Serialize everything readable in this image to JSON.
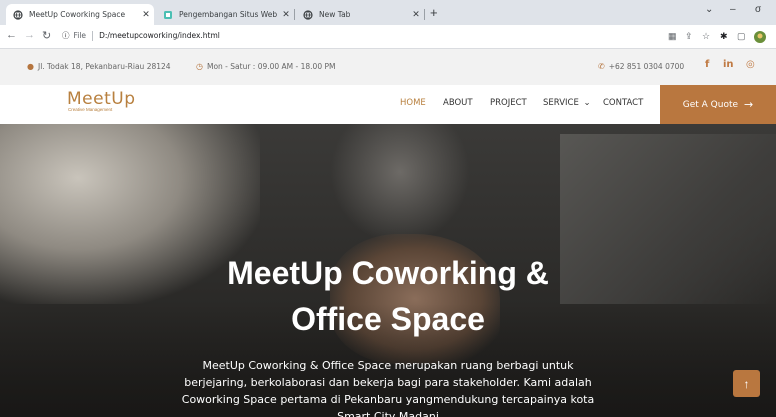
{
  "browser": {
    "tabs": [
      {
        "title": "MeetUp Coworking Space",
        "active": true
      },
      {
        "title": "Pengembangan Situs Web Kusu",
        "active": false
      },
      {
        "title": "New Tab",
        "active": false
      }
    ],
    "new_tab_symbol": "+",
    "url_scheme": "File",
    "url": "D:/meetupcoworking/index.html",
    "window_controls": [
      "⌄",
      "–",
      "σ"
    ]
  },
  "topbar": {
    "address": "Jl. Todak 18, Pekanbaru-Riau 28124",
    "hours": "Mon - Satur : 09.00 AM - 18.00 PM",
    "phone": "+62 851 0304 0700",
    "social": [
      "f",
      "in",
      "◎"
    ]
  },
  "site": {
    "logo_name": "MeetUp",
    "logo_tagline": "Creative Management",
    "menu": [
      "HOME",
      "ABOUT",
      "PROJECT",
      "SERVICE",
      "CONTACT"
    ],
    "service_caret": "⌄",
    "cta": "Get A Quote",
    "cta_arrow": "→"
  },
  "hero": {
    "title_line1": "MeetUp Coworking &",
    "title_line2": "Office Space",
    "desc_line1": "MeetUp Coworking & Office Space merupakan ruang berbagi untuk",
    "desc_line2": "berjejaring, berkolaborasi dan bekerja bagi para stakeholder. Kami adalah",
    "desc_line3": "Coworking Space pertama di Pekanbaru yangmendukung tercapainya kota",
    "desc_line4": "Smart City Madani"
  },
  "scroll_top_icon": "↑",
  "colors": {
    "accent": "#b9773f",
    "hero_bg": "#2f2e2c",
    "topbar_bg": "#f2f2f2"
  }
}
